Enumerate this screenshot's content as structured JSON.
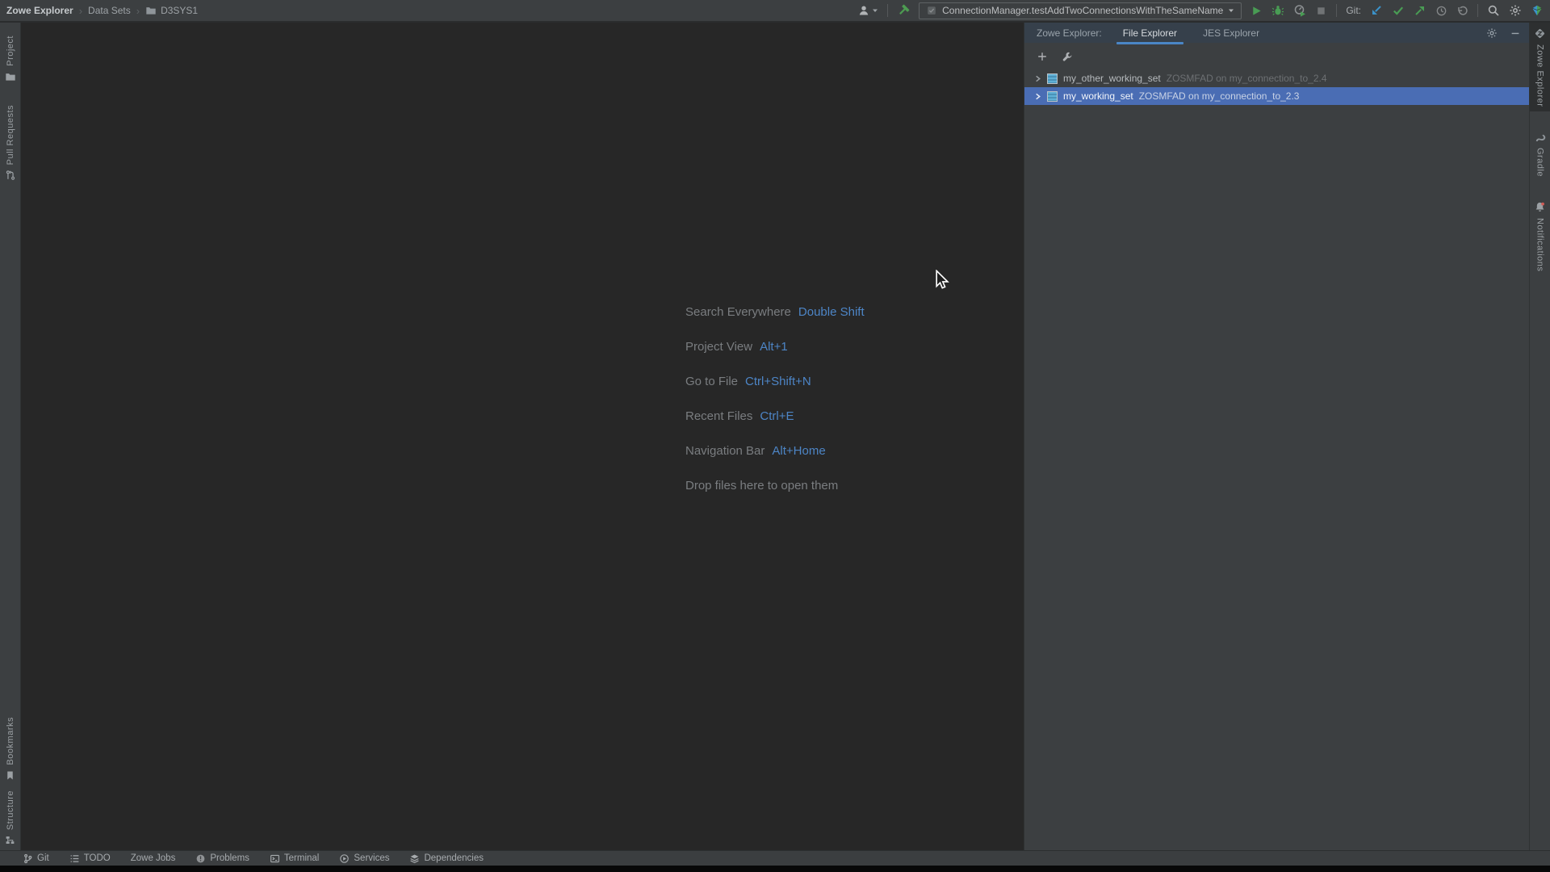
{
  "topbar": {
    "breadcrumb": [
      "Zowe Explorer",
      "Data Sets",
      "D3SYS1"
    ],
    "breadcrumb_separator": "›",
    "run_config": "ConnectionManager.testAddTwoConnectionsWithTheSameName",
    "git_label": "Git:"
  },
  "left_stripe": {
    "items_top": [
      {
        "label": "Project"
      },
      {
        "label": "Pull Requests"
      }
    ],
    "items_bottom": [
      {
        "label": "Bookmarks"
      },
      {
        "label": "Structure"
      }
    ]
  },
  "right_stripe": {
    "items": [
      {
        "label": "Zowe Explorer"
      },
      {
        "label": "Gradle"
      },
      {
        "label": "Notifications"
      }
    ]
  },
  "editor": {
    "shortcuts": [
      {
        "label": "Search Everywhere",
        "keys": "Double Shift"
      },
      {
        "label": "Project View",
        "keys": "Alt+1"
      },
      {
        "label": "Go to File",
        "keys": "Ctrl+Shift+N"
      },
      {
        "label": "Recent Files",
        "keys": "Ctrl+E"
      },
      {
        "label": "Navigation Bar",
        "keys": "Alt+Home"
      }
    ],
    "drop_hint": "Drop files here to open them"
  },
  "panel": {
    "title": "Zowe Explorer:",
    "tabs": [
      {
        "label": "File Explorer"
      },
      {
        "label": "JES Explorer"
      }
    ],
    "rows": [
      {
        "name": "my_other_working_set",
        "detail": "ZOSMFAD on my_connection_to_2.4"
      },
      {
        "name": "my_working_set",
        "detail": "ZOSMFAD on my_connection_to_2.3"
      }
    ]
  },
  "statusbar": {
    "items": [
      {
        "label": "Git"
      },
      {
        "label": "TODO"
      },
      {
        "label": "Zowe Jobs"
      },
      {
        "label": "Problems"
      },
      {
        "label": "Terminal"
      },
      {
        "label": "Services"
      },
      {
        "label": "Dependencies"
      }
    ]
  },
  "colors": {
    "selection_blue": "#4a6db4",
    "shortcut_key_blue": "#4d85c6",
    "tab_underline_blue": "#4a86c6",
    "run_green": "#499c54",
    "git_update_blue": "#3b92c9",
    "panel_header_bg": "#36404b",
    "panel_bg": "#3c3f41",
    "editor_bg": "#272727",
    "notification_dot_red": "#cf5b56"
  }
}
